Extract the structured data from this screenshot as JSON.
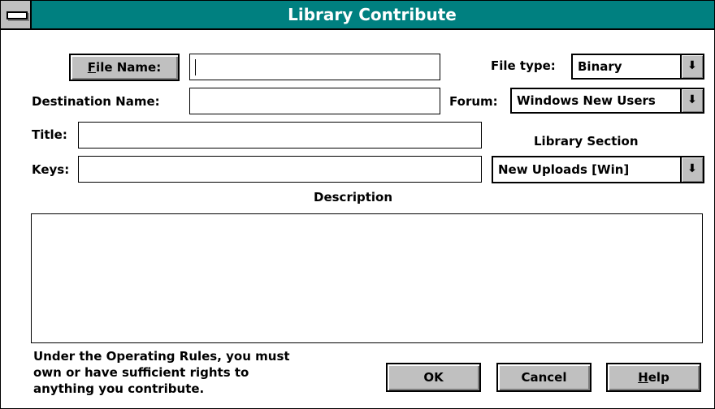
{
  "window": {
    "title": "Library Contribute"
  },
  "form": {
    "file_name_button": {
      "accel": "F",
      "rest": "ile Name:"
    },
    "file_name_value": "",
    "destination_label": "Destination Name:",
    "destination_value": "",
    "title_label": "Title:",
    "title_value": "",
    "keys_label": "Keys:",
    "keys_value": "",
    "file_type_label": "File type:",
    "file_type_value": "Binary",
    "forum_label": "Forum:",
    "forum_value": "Windows New Users",
    "library_section_label": "Library Section",
    "library_section_value": "New Uploads [Win]",
    "description_label": "Description",
    "description_value": ""
  },
  "footer": {
    "rules_lines": [
      "Under the Operating Rules, you must",
      "own or have sufficient rights to",
      "anything you contribute."
    ],
    "ok_label": "OK",
    "cancel_label": "Cancel",
    "help_button": {
      "accel": "H",
      "rest": "elp"
    }
  },
  "icons": {
    "dropdown": "down-arrow-icon",
    "system_menu": "system-menu-icon"
  },
  "colors": {
    "title_bar": "#008080",
    "button_face": "#c0c0c0"
  }
}
